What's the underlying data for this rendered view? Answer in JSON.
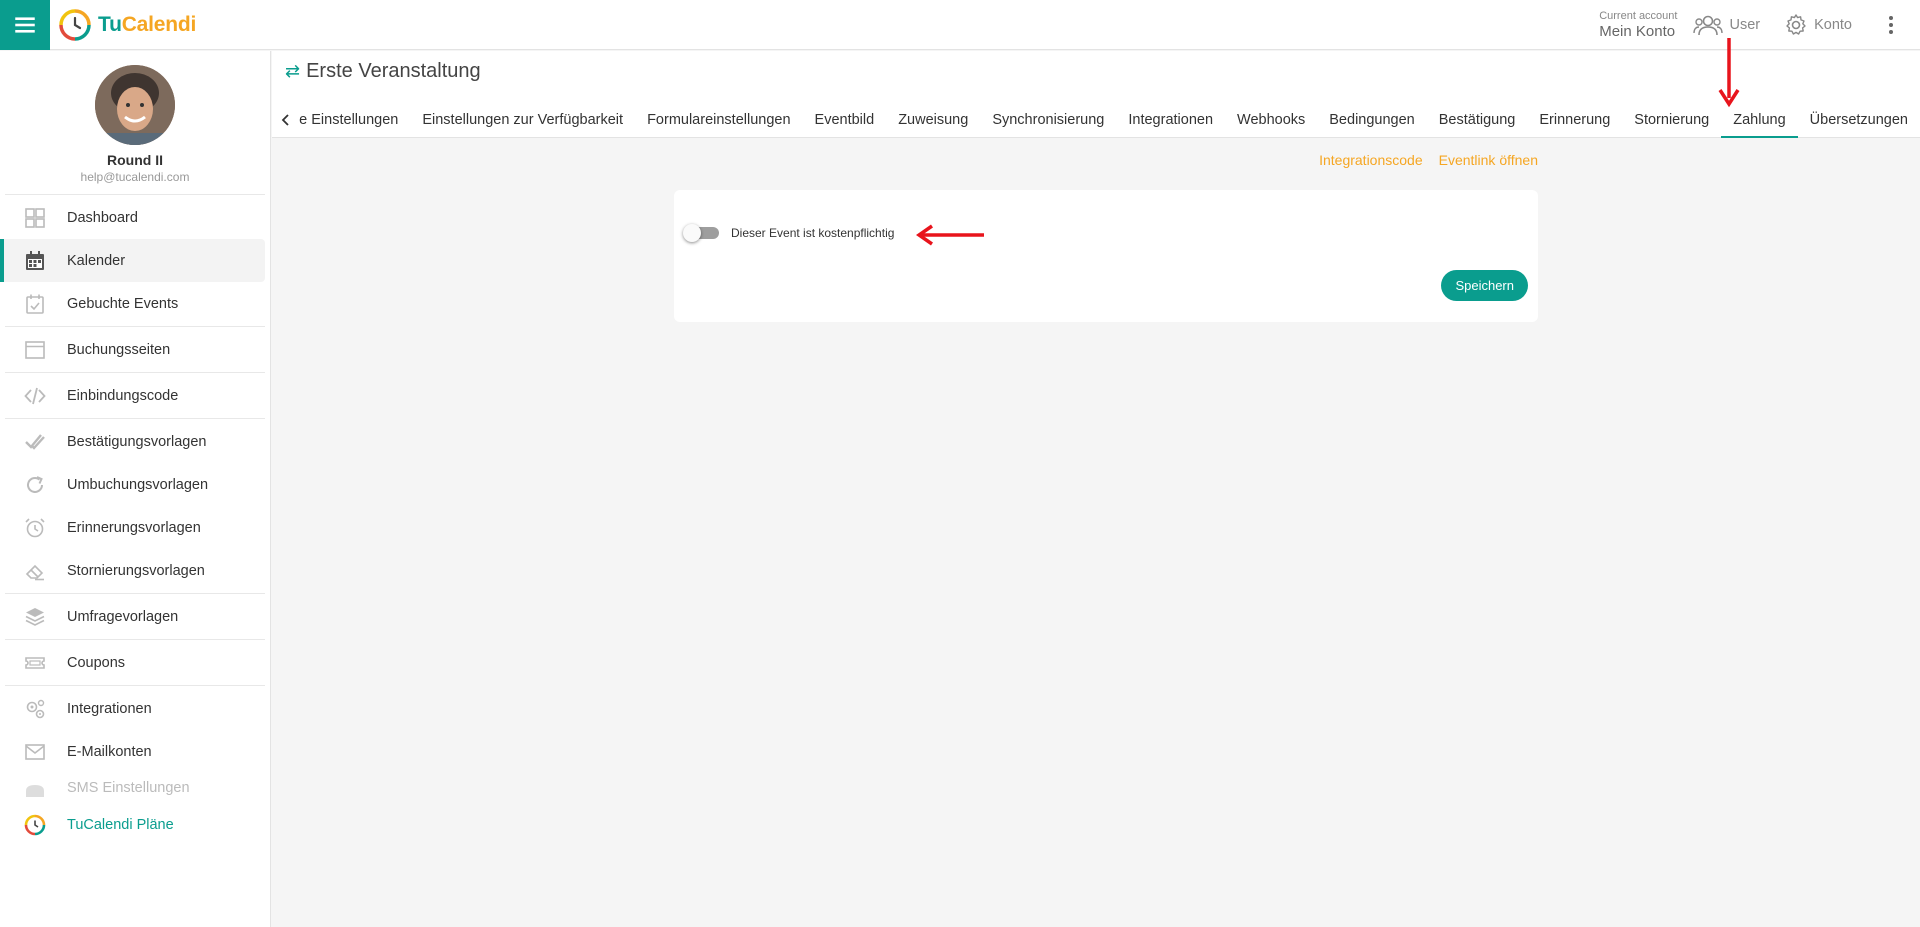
{
  "app": {
    "brand_tu": "Tu",
    "brand_cal": "Calendi",
    "colors": {
      "primary": "#0a9d8e",
      "accent": "#f5a623"
    }
  },
  "topbar": {
    "account_small": "Current account",
    "account_main": "Mein Konto",
    "user_label": "User",
    "konto_label": "Konto"
  },
  "profile": {
    "name": "Round II",
    "email": "help@tucalendi.com"
  },
  "sidebar": {
    "items": [
      {
        "label": "Dashboard",
        "icon": "dashboard-icon"
      },
      {
        "label": "Kalender",
        "icon": "calendar-icon",
        "active": true
      },
      {
        "label": "Gebuchte Events",
        "icon": "calendar-check-icon"
      },
      {
        "label": "Buchungsseiten",
        "icon": "browser-window-icon"
      },
      {
        "label": "Einbindungscode",
        "icon": "code-icon"
      },
      {
        "label": "Bestätigungsvorlagen",
        "icon": "double-check-icon"
      },
      {
        "label": "Umbuchungsvorlagen",
        "icon": "refresh-icon"
      },
      {
        "label": "Erinnerungsvorlagen",
        "icon": "alarm-clock-icon"
      },
      {
        "label": "Stornierungsvorlagen",
        "icon": "eraser-icon"
      },
      {
        "label": "Umfragevorlagen",
        "icon": "layers-icon"
      },
      {
        "label": "Coupons",
        "icon": "ticket-icon"
      },
      {
        "label": "Integrationen",
        "icon": "gears-icon"
      },
      {
        "label": "E-Mailkonten",
        "icon": "mail-icon"
      },
      {
        "label": "SMS Einstellungen",
        "icon": "sms-icon"
      },
      {
        "label": "TuCalendi Pläne",
        "icon": "tucalendi-logo-icon"
      }
    ]
  },
  "header": {
    "title": "Erste Veranstaltung",
    "tabs": [
      "e Einstellungen",
      "Einstellungen zur Verfügbarkeit",
      "Formulareinstellungen",
      "Eventbild",
      "Zuweisung",
      "Synchronisierung",
      "Integrationen",
      "Webhooks",
      "Bedingungen",
      "Bestätigung",
      "Erinnerung",
      "Stornierung",
      "Zahlung",
      "Übersetzungen"
    ],
    "active_tab": "Zahlung"
  },
  "content": {
    "link_integration": "Integrationscode",
    "link_event": "Eventlink öffnen",
    "toggle_label": "Dieser Event ist kostenpflichtig",
    "toggle_on": false,
    "save_label": "Speichern"
  }
}
